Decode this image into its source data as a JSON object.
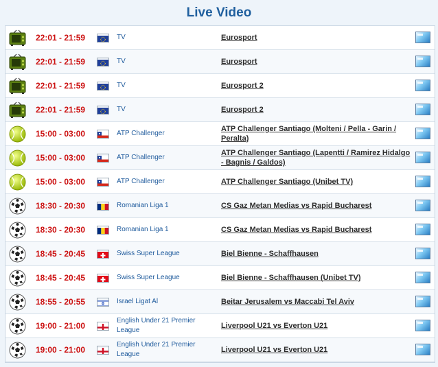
{
  "page": {
    "title": "Live Video"
  },
  "rows": [
    {
      "sport": "tv",
      "time": "22:01 - 21:59",
      "flag": "eu",
      "competition": "TV",
      "event": "Eurosport"
    },
    {
      "sport": "tv",
      "time": "22:01 - 21:59",
      "flag": "eu",
      "competition": "TV",
      "event": "Eurosport"
    },
    {
      "sport": "tv",
      "time": "22:01 - 21:59",
      "flag": "eu",
      "competition": "TV",
      "event": "Eurosport 2"
    },
    {
      "sport": "tv",
      "time": "22:01 - 21:59",
      "flag": "eu",
      "competition": "TV",
      "event": "Eurosport 2"
    },
    {
      "sport": "tennis",
      "time": "15:00 - 03:00",
      "flag": "chile",
      "competition": "ATP Challenger",
      "event": "ATP Challenger Santiago (Molteni / Pella - Garin / Peralta)"
    },
    {
      "sport": "tennis",
      "time": "15:00 - 03:00",
      "flag": "chile",
      "competition": "ATP Challenger",
      "event": "ATP Challenger Santiago (Lapentti / Ramirez Hidalgo - Bagnis / Galdos)"
    },
    {
      "sport": "tennis",
      "time": "15:00 - 03:00",
      "flag": "chile",
      "competition": "ATP Challenger",
      "event": "ATP Challenger Santiago (Unibet TV)"
    },
    {
      "sport": "soccer",
      "time": "18:30 - 20:30",
      "flag": "romania",
      "competition": "Romanian Liga 1",
      "event": "CS Gaz Metan Medias vs Rapid Bucharest"
    },
    {
      "sport": "soccer",
      "time": "18:30 - 20:30",
      "flag": "romania",
      "competition": "Romanian Liga 1",
      "event": "CS Gaz Metan Medias vs Rapid Bucharest"
    },
    {
      "sport": "soccer",
      "time": "18:45 - 20:45",
      "flag": "switzerland",
      "competition": "Swiss Super League",
      "event": "Biel Bienne - Schaffhausen"
    },
    {
      "sport": "soccer",
      "time": "18:45 - 20:45",
      "flag": "switzerland",
      "competition": "Swiss Super League",
      "event": "Biel Bienne - Schaffhausen (Unibet TV)"
    },
    {
      "sport": "soccer",
      "time": "18:55 - 20:55",
      "flag": "israel",
      "competition": "Israel Ligat Al",
      "event": "Beitar Jerusalem vs Maccabi Tel Aviv"
    },
    {
      "sport": "soccer",
      "time": "19:00 - 21:00",
      "flag": "england",
      "competition": "English Under 21 Premier League",
      "event": "Liverpool U21 vs Everton U21"
    },
    {
      "sport": "soccer",
      "time": "19:00 - 21:00",
      "flag": "england",
      "competition": "English Under 21 Premier League",
      "event": "Liverpool U21 vs Everton U21"
    }
  ],
  "colors": {
    "title": "#1f5f9e",
    "time": "#cc1111",
    "competition": "#1e5a9c",
    "event": "#2c2c2c",
    "background": "#eef4fa"
  }
}
